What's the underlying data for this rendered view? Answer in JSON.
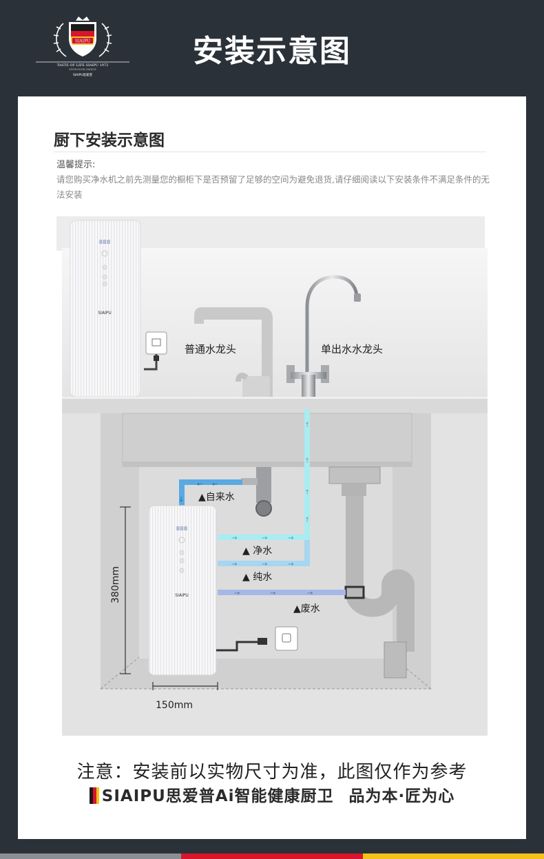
{
  "header": {
    "title": "安装示意图",
    "logo": {
      "badge_text": "SIAIPU",
      "tagline": "TASTE OF LIFE SIAIPU 1972",
      "subline": "YOUR GOOD CHOICE",
      "brand_small": "SIAIPU思爱普"
    }
  },
  "section": {
    "title": "厨下安装示意图",
    "tip_heading": "温馨提示:",
    "tip_text": "请您购买净水机之前先测量您的橱柜下是否预留了足够的空间为避免退货,请仔细阅读以下安装条件不满足条件的无法安装"
  },
  "diagram": {
    "purifier_brand": "SIAIPU",
    "purifier_display": "888",
    "labels": {
      "normal_faucet": "普通水龙头",
      "single_faucet": "单出水水龙头",
      "tap_water": "▲自来水",
      "clean_water": "▲ 净水",
      "pure_water": "▲ 纯水",
      "waste_water": "▲废水"
    },
    "dimensions": {
      "height": "380mm",
      "width": "150mm"
    },
    "colors": {
      "tap_water_pipe": "#5aa9e0",
      "clean_water_pipe": "#a9ecf2",
      "pure_water_pipe": "#a7d6f0",
      "waste_water_pipe": "#a6b8e6"
    }
  },
  "footer": {
    "note": "注意：安装前以实物尺寸为准，此图仅作为参考",
    "brand_line": "SIAIPU思爱普Ai智能健康厨卫",
    "slogan": "品为本·匠为心"
  },
  "stripe_colors": [
    "#8a8f96",
    "#d7162c",
    "#f4c21a"
  ]
}
